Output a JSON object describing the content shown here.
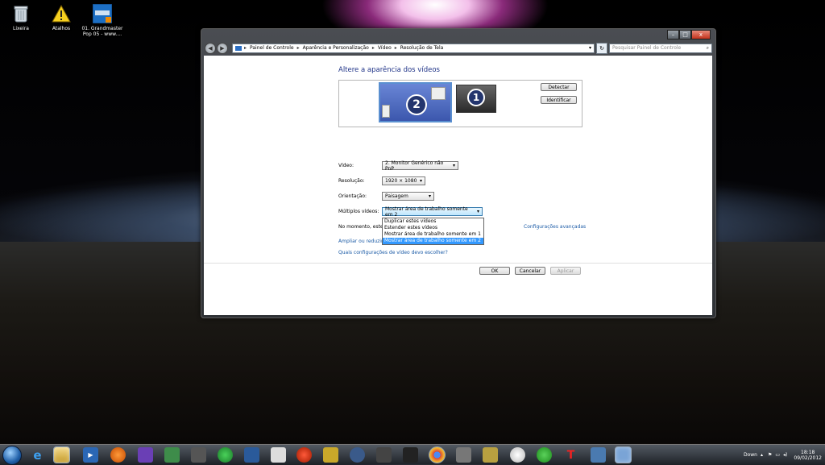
{
  "desktop": {
    "icons": [
      {
        "label": "Lixeira",
        "icon": "recycle-bin-icon"
      },
      {
        "label": "Atalhos",
        "icon": "warning-icon"
      },
      {
        "label": "01. Grandmaster Pop 05 - www....",
        "icon": "music-file-icon"
      }
    ]
  },
  "window": {
    "caption": {
      "minimize": "–",
      "maximize": "□",
      "close": "x"
    },
    "breadcrumb": [
      "Painel de Controle",
      "Aparência e Personalização",
      "Vídeo",
      "Resolução de Tela"
    ],
    "search_placeholder": "Pesquisar Painel de Controle",
    "heading": "Altere a aparência dos vídeos",
    "monitor_numbers": [
      "2",
      "1"
    ],
    "detect_label": "Detectar",
    "identify_label": "Identificar",
    "fields": {
      "video_label": "Vídeo:",
      "video_value": "2. Monitor Genérico não PnP",
      "resolution_label": "Resolução:",
      "resolution_value": "1920 × 1080",
      "orientation_label": "Orientação:",
      "orientation_value": "Paisagem",
      "multiple_label": "Múltiplos vídeos:",
      "multiple_value": "Mostrar área de trabalho somente em 2"
    },
    "dropdown_options": [
      "Duplicar estes vídeos",
      "Estender estes vídeos",
      "Mostrar área de trabalho somente em 1",
      "Mostrar área de trabalho somente em 2"
    ],
    "selected_option_index": 3,
    "status_text": "No momento, este",
    "advanced_link": "Configurações avançadas",
    "zoom_link": "Ampliar ou reduzir",
    "help_link": "Quais configurações de vídeo devo escolher?",
    "ok_label": "OK",
    "cancel_label": "Cancelar",
    "apply_label": "Aplicar"
  },
  "taskbar": {
    "tray_text": "Down",
    "time": "18:18",
    "date": "09/02/2012"
  },
  "colors": {
    "accent": "#1e3287",
    "link": "#1a5aa6",
    "selection": "#3399ff"
  }
}
